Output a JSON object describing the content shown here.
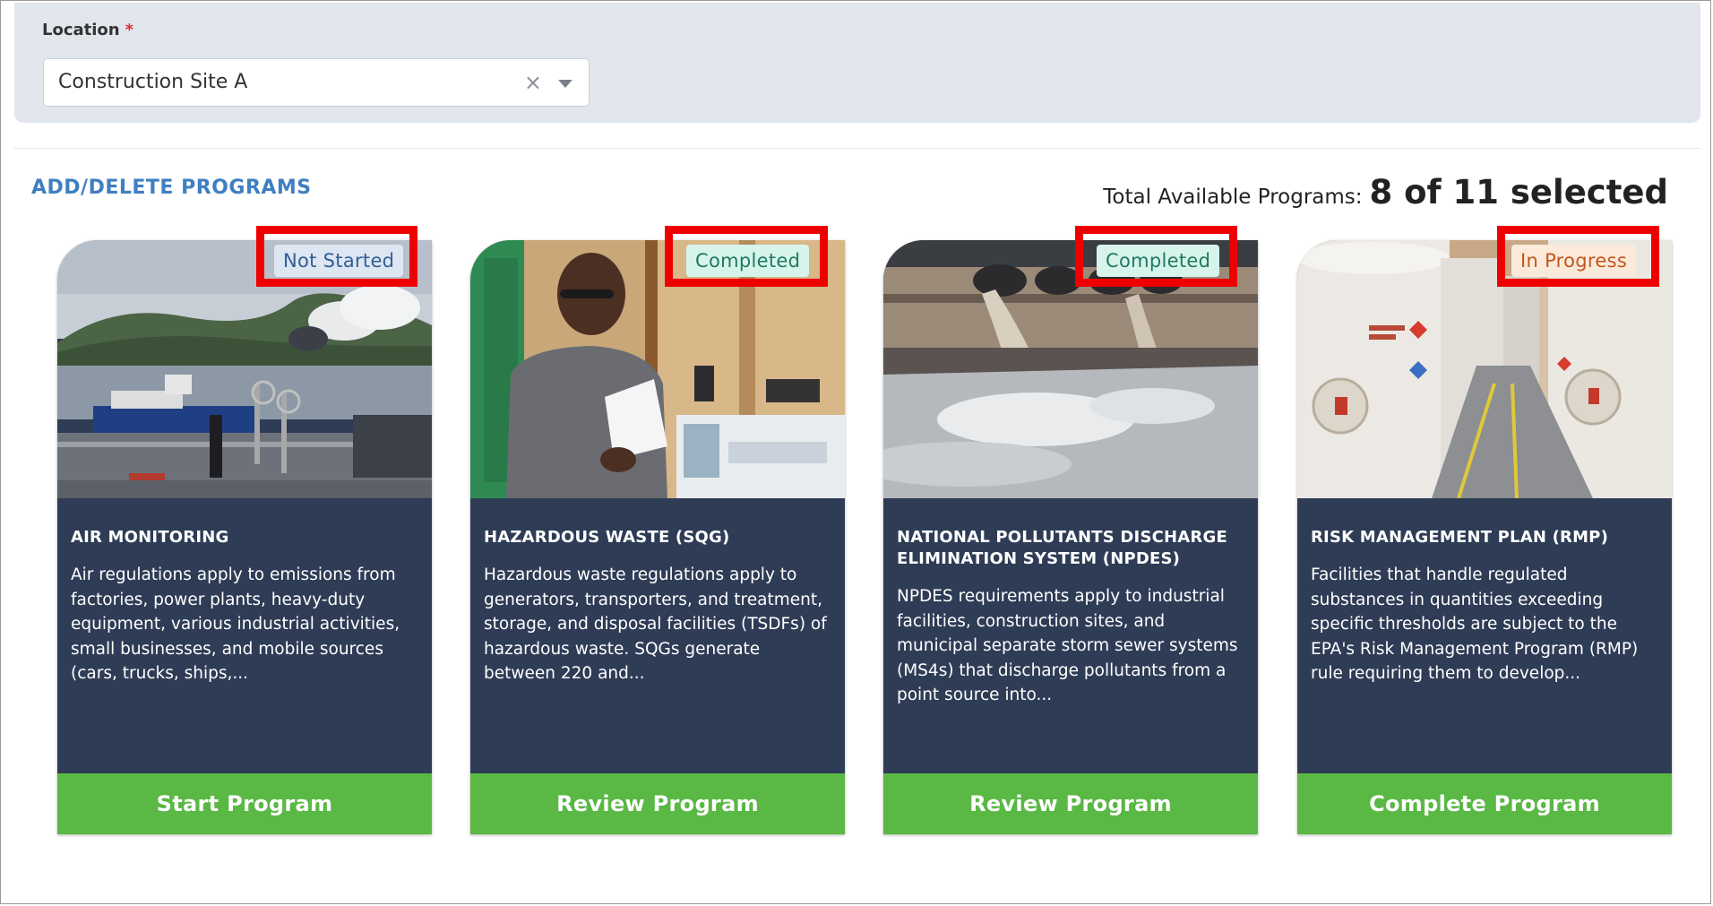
{
  "location": {
    "label": "Location",
    "required_mark": "*",
    "value": "Construction Site A",
    "clear_glyph": "×"
  },
  "programs_header": {
    "add_delete_label": "ADD/DELETE PROGRAMS",
    "total_label": "Total Available Programs:",
    "total_value": "8 of 11 selected"
  },
  "programs": [
    {
      "status": "Not Started",
      "title": "AIR MONITORING",
      "description": "Air regulations apply to emissions from factories, power plants, heavy-duty equipment, various industrial activities, small businesses, and mobile sources (cars, trucks, ships,...",
      "button": "Start Program",
      "image_icon": "industrial-port-smokestack-photo"
    },
    {
      "status": "Completed",
      "title": "HAZARDOUS WASTE (SQG)",
      "description": "Hazardous waste regulations apply to generators, transporters, and treatment, storage, and disposal facilities (TSDFs) of hazardous waste. SQGs generate between 220 and...",
      "button": "Review Program",
      "image_icon": "worker-reading-document-photo"
    },
    {
      "status": "Completed",
      "title": "NATIONAL POLLUTANTS DISCHARGE ELIMINATION SYSTEM (NPDES)",
      "description": "NPDES requirements apply to industrial facilities, construction sites, and municipal separate storm sewer systems (MS4s) that discharge pollutants from a point source into...",
      "button": "Review Program",
      "image_icon": "wastewater-outfall-photo"
    },
    {
      "status": "In Progress",
      "title": "RISK MANAGEMENT PLAN (RMP)",
      "description": "Facilities that handle regulated substances in quantities exceeding specific thresholds are subject to the EPA's Risk Management Program (RMP) rule requiring them to develop...",
      "button": "Complete Program",
      "image_icon": "chemical-storage-tanks-photo"
    }
  ],
  "colors": {
    "card_body": "#2e3c56",
    "button_green": "#5ab845",
    "link_blue": "#3f7fc1",
    "highlight_red": "#ee0000"
  }
}
